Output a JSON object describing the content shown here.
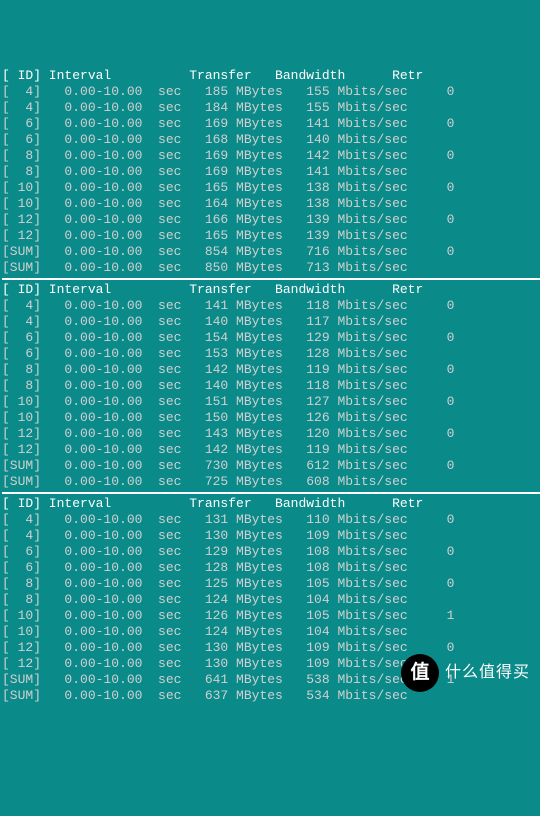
{
  "headers": {
    "id": "[ ID]",
    "interval": "Interval",
    "transfer": "Transfer",
    "bandwidth": "Bandwidth",
    "retr": "Retr"
  },
  "fmt": {
    "interval": "0.00-10.00",
    "sec": "sec",
    "mb": "MBytes",
    "mbps": "Mbits/sec"
  },
  "watermark": {
    "logo_text": "值",
    "label": "什么值得买"
  },
  "blocks": [
    {
      "rows": [
        {
          "id": "  4",
          "transfer": "185",
          "bw": "155",
          "retr": "0"
        },
        {
          "id": "  4",
          "transfer": "184",
          "bw": "155",
          "retr": ""
        },
        {
          "id": "  6",
          "transfer": "169",
          "bw": "141",
          "retr": "0"
        },
        {
          "id": "  6",
          "transfer": "168",
          "bw": "140",
          "retr": ""
        },
        {
          "id": "  8",
          "transfer": "169",
          "bw": "142",
          "retr": "0"
        },
        {
          "id": "  8",
          "transfer": "169",
          "bw": "141",
          "retr": ""
        },
        {
          "id": " 10",
          "transfer": "165",
          "bw": "138",
          "retr": "0"
        },
        {
          "id": " 10",
          "transfer": "164",
          "bw": "138",
          "retr": ""
        },
        {
          "id": " 12",
          "transfer": "166",
          "bw": "139",
          "retr": "0"
        },
        {
          "id": " 12",
          "transfer": "165",
          "bw": "139",
          "retr": ""
        },
        {
          "id": "SUM",
          "transfer": "854",
          "bw": "716",
          "retr": "0"
        },
        {
          "id": "SUM",
          "transfer": "850",
          "bw": "713",
          "retr": ""
        }
      ]
    },
    {
      "rows": [
        {
          "id": "  4",
          "transfer": "141",
          "bw": "118",
          "retr": "0"
        },
        {
          "id": "  4",
          "transfer": "140",
          "bw": "117",
          "retr": ""
        },
        {
          "id": "  6",
          "transfer": "154",
          "bw": "129",
          "retr": "0"
        },
        {
          "id": "  6",
          "transfer": "153",
          "bw": "128",
          "retr": ""
        },
        {
          "id": "  8",
          "transfer": "142",
          "bw": "119",
          "retr": "0"
        },
        {
          "id": "  8",
          "transfer": "140",
          "bw": "118",
          "retr": ""
        },
        {
          "id": " 10",
          "transfer": "151",
          "bw": "127",
          "retr": "0"
        },
        {
          "id": " 10",
          "transfer": "150",
          "bw": "126",
          "retr": ""
        },
        {
          "id": " 12",
          "transfer": "143",
          "bw": "120",
          "retr": "0"
        },
        {
          "id": " 12",
          "transfer": "142",
          "bw": "119",
          "retr": ""
        },
        {
          "id": "SUM",
          "transfer": "730",
          "bw": "612",
          "retr": "0"
        },
        {
          "id": "SUM",
          "transfer": "725",
          "bw": "608",
          "retr": ""
        }
      ]
    },
    {
      "rows": [
        {
          "id": "  4",
          "transfer": "131",
          "bw": "110",
          "retr": "0"
        },
        {
          "id": "  4",
          "transfer": "130",
          "bw": "109",
          "retr": ""
        },
        {
          "id": "  6",
          "transfer": "129",
          "bw": "108",
          "retr": "0"
        },
        {
          "id": "  6",
          "transfer": "128",
          "bw": "108",
          "retr": ""
        },
        {
          "id": "  8",
          "transfer": "125",
          "bw": "105",
          "retr": "0"
        },
        {
          "id": "  8",
          "transfer": "124",
          "bw": "104",
          "retr": ""
        },
        {
          "id": " 10",
          "transfer": "126",
          "bw": "105",
          "retr": "1"
        },
        {
          "id": " 10",
          "transfer": "124",
          "bw": "104",
          "retr": ""
        },
        {
          "id": " 12",
          "transfer": "130",
          "bw": "109",
          "retr": "0"
        },
        {
          "id": " 12",
          "transfer": "130",
          "bw": "109",
          "retr": ""
        },
        {
          "id": "SUM",
          "transfer": "641",
          "bw": "538",
          "retr": "1"
        },
        {
          "id": "SUM",
          "transfer": "637",
          "bw": "534",
          "retr": ""
        }
      ]
    }
  ]
}
